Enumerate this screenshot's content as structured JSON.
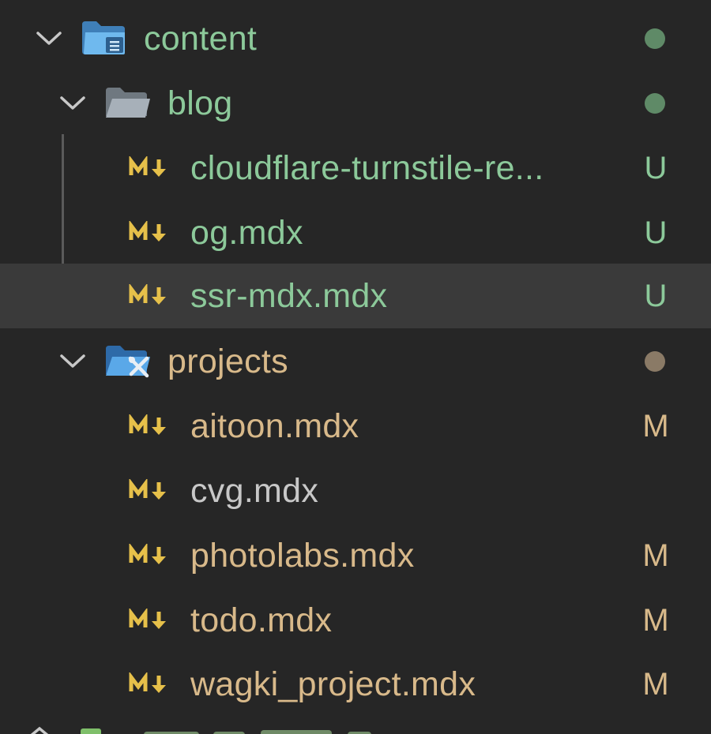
{
  "colors": {
    "background": "#262626",
    "selected_row": "#3a3a3a",
    "untracked_green": "#8cc99a",
    "modified_tan": "#d8b98a",
    "plain_gray": "#c8c8c8",
    "md_yellow": "#e6c04a",
    "folder_blue": "#5aa8e8",
    "folder_gray": "#9aa3ad",
    "dot_green": "#5f8a67",
    "dot_tan": "#8a7a66"
  },
  "tree": {
    "content": {
      "label": "content",
      "icon": "folder-open-blue-icon",
      "status_dot": "green"
    },
    "blog": {
      "label": "blog",
      "icon": "folder-open-gray-icon",
      "status_dot": "green"
    },
    "blog_files": [
      {
        "label": "cloudflare-turnstile-re...",
        "status": "U"
      },
      {
        "label": "og.mdx",
        "status": "U"
      },
      {
        "label": "ssr-mdx.mdx",
        "status": "U"
      }
    ],
    "projects": {
      "label": "projects",
      "icon": "folder-projects-icon",
      "status_dot": "tan"
    },
    "project_files": [
      {
        "label": "aitoon.mdx",
        "status": "M"
      },
      {
        "label": "cvg.mdx",
        "status": ""
      },
      {
        "label": "photolabs.mdx",
        "status": "M"
      },
      {
        "label": "todo.mdx",
        "status": "M"
      },
      {
        "label": "wagki_project.mdx",
        "status": "M"
      }
    ]
  }
}
